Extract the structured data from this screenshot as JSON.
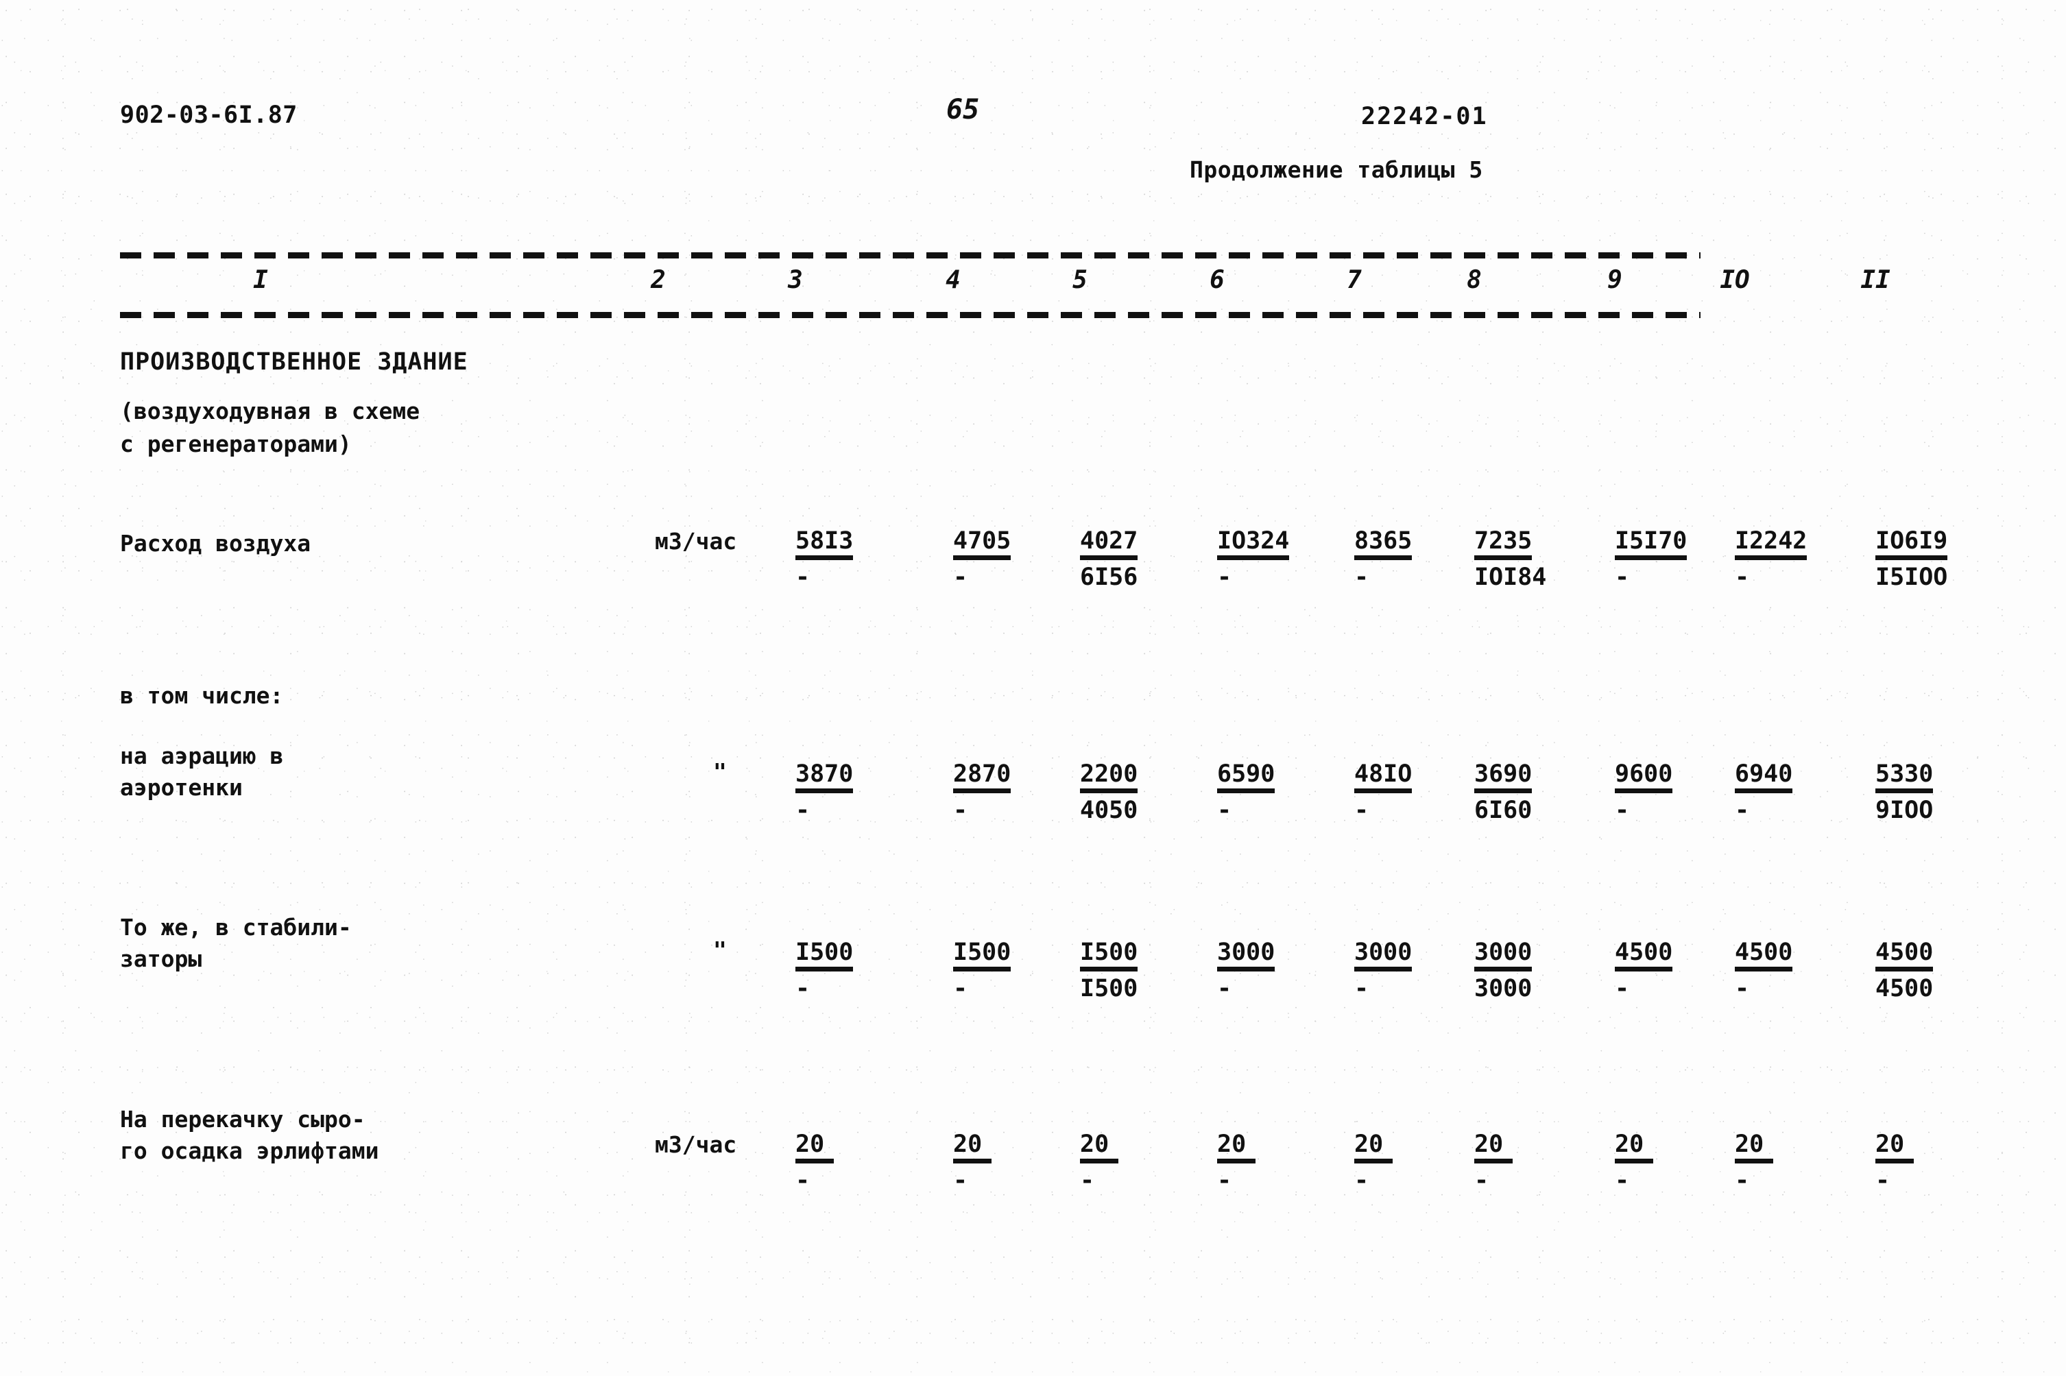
{
  "header": {
    "doc_code": "902-03-6I.87",
    "page_number": "65",
    "sheet_code": "22242-01",
    "table_continuation": "Продолжение таблицы 5"
  },
  "table": {
    "column_headers": [
      "I",
      "2",
      "3",
      "4",
      "5",
      "6",
      "7",
      "8",
      "9",
      "IO",
      "II"
    ],
    "section": {
      "title": "ПРОИЗВОДСТВЕННОЕ ЗДАНИЕ",
      "sub_line_1": "(воздуходувная в схеме",
      "sub_line_2": "с регенераторами)"
    },
    "group_label": "в том числе:",
    "rows": [
      {
        "label_line_1": "Расход воздуха",
        "label_line_2": "",
        "unit": "м3/час",
        "values": [
          {
            "top": "58I3",
            "bottom": "-"
          },
          {
            "top": "4705",
            "bottom": "-"
          },
          {
            "top": "4027",
            "bottom": "6I56"
          },
          {
            "top": "IO324",
            "bottom": "-"
          },
          {
            "top": "8365",
            "bottom": "-"
          },
          {
            "top": "7235",
            "bottom": "IOI84"
          },
          {
            "top": "I5I70",
            "bottom": "-"
          },
          {
            "top": "I2242",
            "bottom": "-"
          },
          {
            "top": "IO6I9",
            "bottom": "I5IOO"
          }
        ]
      },
      {
        "label_line_1": "на аэрацию в",
        "label_line_2": "аэротенки",
        "unit": "\"",
        "values": [
          {
            "top": "3870",
            "bottom": "-"
          },
          {
            "top": "2870",
            "bottom": "-"
          },
          {
            "top": "2200",
            "bottom": "4050"
          },
          {
            "top": "6590",
            "bottom": "-"
          },
          {
            "top": "48IO",
            "bottom": "-"
          },
          {
            "top": "3690",
            "bottom": "6I60"
          },
          {
            "top": "9600",
            "bottom": "-"
          },
          {
            "top": "6940",
            "bottom": "-"
          },
          {
            "top": "5330",
            "bottom": "9IOO"
          }
        ]
      },
      {
        "label_line_1": "То же, в стабили-",
        "label_line_2": "заторы",
        "unit": "\"",
        "values": [
          {
            "top": "I500",
            "bottom": "-"
          },
          {
            "top": "I500",
            "bottom": "-"
          },
          {
            "top": "I500",
            "bottom": "I500"
          },
          {
            "top": "3000",
            "bottom": "-"
          },
          {
            "top": "3000",
            "bottom": "-"
          },
          {
            "top": "3000",
            "bottom": "3000"
          },
          {
            "top": "4500",
            "bottom": "-"
          },
          {
            "top": "4500",
            "bottom": "-"
          },
          {
            "top": "4500",
            "bottom": "4500"
          }
        ]
      },
      {
        "label_line_1": "На перекачку сыро-",
        "label_line_2": "го осадка эрлифтами",
        "unit": "м3/час",
        "values": [
          {
            "top": "20",
            "bottom": "-"
          },
          {
            "top": "20",
            "bottom": "-"
          },
          {
            "top": "20",
            "bottom": "-"
          },
          {
            "top": "20",
            "bottom": "-"
          },
          {
            "top": "20",
            "bottom": "-"
          },
          {
            "top": "20",
            "bottom": "-"
          },
          {
            "top": "20",
            "bottom": "-"
          },
          {
            "top": "20",
            "bottom": "-"
          },
          {
            "top": "20",
            "bottom": "-"
          }
        ]
      }
    ]
  }
}
